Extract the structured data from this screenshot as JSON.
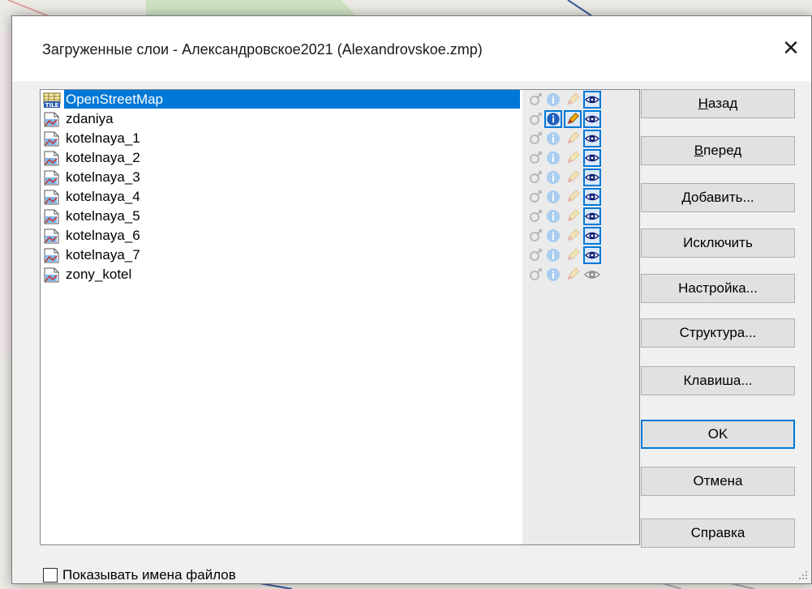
{
  "dialog": {
    "title": "Загруженные слои - Александровское2021 (Alexandrovskoe.zmp)",
    "close_glyph": "✕"
  },
  "layers": [
    {
      "name": "OpenStreetMap",
      "icon": "tile-layer-icon",
      "selected": true,
      "info_active": false,
      "edit_active": false,
      "visible": true
    },
    {
      "name": "zdaniya",
      "icon": "vector-layer-icon",
      "selected": false,
      "info_active": true,
      "edit_active": true,
      "visible": true
    },
    {
      "name": "kotelnaya_1",
      "icon": "vector-layer-icon",
      "selected": false,
      "info_active": false,
      "edit_active": false,
      "visible": true
    },
    {
      "name": "kotelnaya_2",
      "icon": "vector-layer-icon",
      "selected": false,
      "info_active": false,
      "edit_active": false,
      "visible": true
    },
    {
      "name": "kotelnaya_3",
      "icon": "vector-layer-icon",
      "selected": false,
      "info_active": false,
      "edit_active": false,
      "visible": true
    },
    {
      "name": "kotelnaya_4",
      "icon": "vector-layer-icon",
      "selected": false,
      "info_active": false,
      "edit_active": false,
      "visible": true
    },
    {
      "name": "kotelnaya_5",
      "icon": "vector-layer-icon",
      "selected": false,
      "info_active": false,
      "edit_active": false,
      "visible": true
    },
    {
      "name": "kotelnaya_6",
      "icon": "vector-layer-icon",
      "selected": false,
      "info_active": false,
      "edit_active": false,
      "visible": true
    },
    {
      "name": "kotelnaya_7",
      "icon": "vector-layer-icon",
      "selected": false,
      "info_active": false,
      "edit_active": false,
      "visible": true
    },
    {
      "name": "zony_kotel",
      "icon": "vector-layer-icon",
      "selected": false,
      "info_active": false,
      "edit_active": false,
      "visible": false
    }
  ],
  "buttons": {
    "back": {
      "mnemonic": "Н",
      "rest": "азад"
    },
    "forward": {
      "mnemonic": "В",
      "rest": "перед"
    },
    "add": "Добавить...",
    "exclude": "Исключить",
    "settings": "Настройка...",
    "structure": "Структура...",
    "key": "Клавиша...",
    "ok": "OK",
    "cancel": "Отмена",
    "help": "Справка"
  },
  "show_filenames": {
    "label": "Показывать имена файлов",
    "checked": false
  },
  "colors": {
    "accent": "#0078d7",
    "selection": "#0078d7"
  }
}
